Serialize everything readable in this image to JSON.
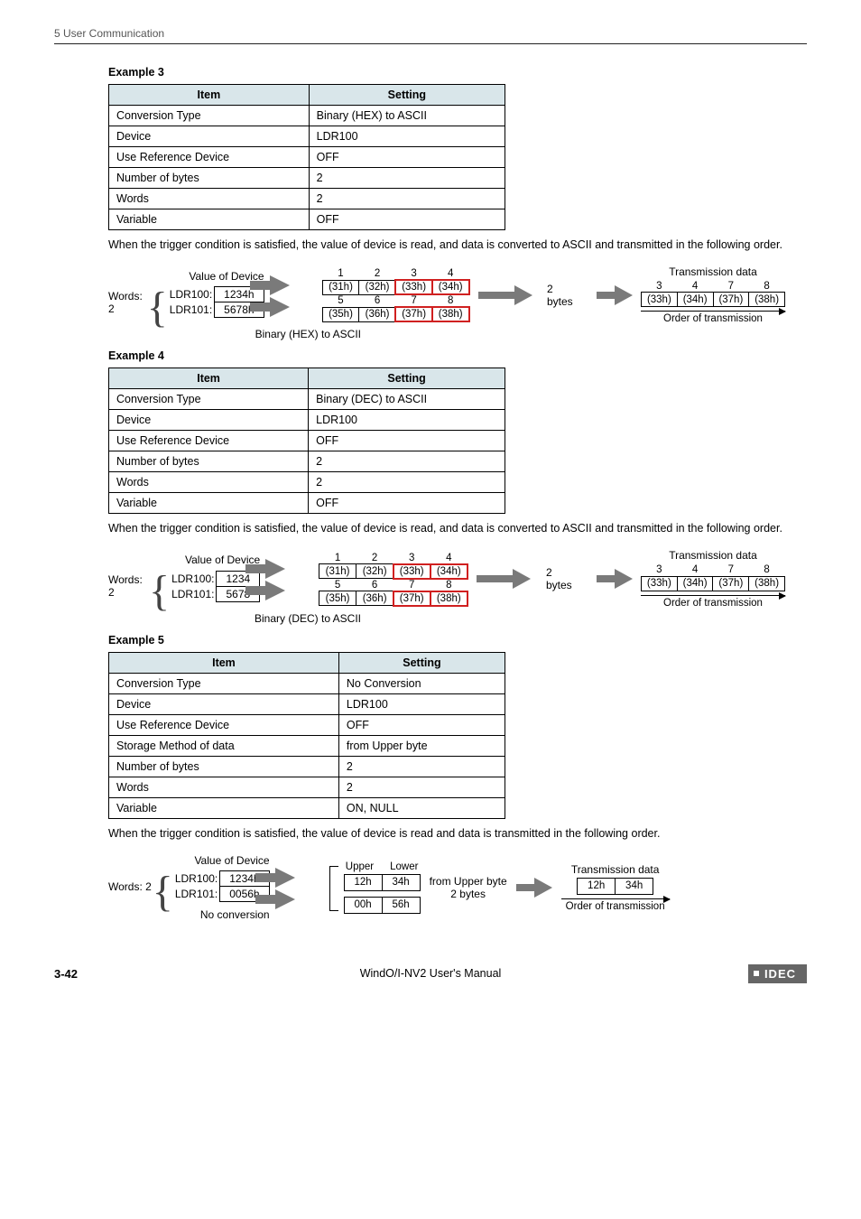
{
  "header": {
    "chapter": "5 User Communication"
  },
  "example3": {
    "title": "Example 3",
    "headers": {
      "item": "Item",
      "setting": "Setting"
    },
    "rows": [
      {
        "item": "Conversion Type",
        "setting": "Binary (HEX) to ASCII"
      },
      {
        "item": "Device",
        "setting": "LDR100"
      },
      {
        "item": "Use Reference Device",
        "setting": "OFF"
      },
      {
        "item": "Number of bytes",
        "setting": "2"
      },
      {
        "item": "Words",
        "setting": "2"
      },
      {
        "item": "Variable",
        "setting": "OFF"
      }
    ],
    "para": "When the trigger condition is satisfied, the value of device is read, and data is converted to ASCII and transmitted in the following order.",
    "diagram": {
      "vod": "Value of Device",
      "words": "Words: 2",
      "ldr": [
        {
          "name": "LDR100:",
          "val": "1234h"
        },
        {
          "name": "LDR101:",
          "val": "5678h"
        }
      ],
      "conv": "Binary (HEX) to ASCII",
      "grid8": {
        "idx": [
          "1",
          "2",
          "3",
          "4",
          "5",
          "6",
          "7",
          "8"
        ],
        "cells": [
          "(31h)",
          "(32h)",
          "(33h)",
          "(34h)",
          "(35h)",
          "(36h)",
          "(37h)",
          "(38h)"
        ]
      },
      "bytes": "2 bytes",
      "transLabel": "Transmission data",
      "trans": {
        "idx": [
          "3",
          "4",
          "7",
          "8"
        ],
        "cells": [
          "(33h)",
          "(34h)",
          "(37h)",
          "(38h)"
        ]
      },
      "order": "Order of transmission"
    }
  },
  "example4": {
    "title": "Example 4",
    "headers": {
      "item": "Item",
      "setting": "Setting"
    },
    "rows": [
      {
        "item": "Conversion Type",
        "setting": "Binary (DEC) to ASCII"
      },
      {
        "item": "Device",
        "setting": "LDR100"
      },
      {
        "item": "Use Reference Device",
        "setting": "OFF"
      },
      {
        "item": "Number of bytes",
        "setting": "2"
      },
      {
        "item": "Words",
        "setting": "2"
      },
      {
        "item": "Variable",
        "setting": "OFF"
      }
    ],
    "para": "When the trigger condition is satisfied, the value of device is read, and data is converted to ASCII and transmitted in the following order.",
    "diagram": {
      "vod": "Value of Device",
      "words": "Words: 2",
      "ldr": [
        {
          "name": "LDR100:",
          "val": "1234"
        },
        {
          "name": "LDR101:",
          "val": "5678"
        }
      ],
      "conv": "Binary (DEC) to ASCII",
      "grid8": {
        "idx": [
          "1",
          "2",
          "3",
          "4",
          "5",
          "6",
          "7",
          "8"
        ],
        "cells": [
          "(31h)",
          "(32h)",
          "(33h)",
          "(34h)",
          "(35h)",
          "(36h)",
          "(37h)",
          "(38h)"
        ]
      },
      "bytes": "2 bytes",
      "transLabel": "Transmission data",
      "trans": {
        "idx": [
          "3",
          "4",
          "7",
          "8"
        ],
        "cells": [
          "(33h)",
          "(34h)",
          "(37h)",
          "(38h)"
        ]
      },
      "order": "Order of transmission"
    }
  },
  "example5": {
    "title": "Example 5",
    "headers": {
      "item": "Item",
      "setting": "Setting"
    },
    "rows": [
      {
        "item": "Conversion Type",
        "setting": "No Conversion"
      },
      {
        "item": "Device",
        "setting": "LDR100"
      },
      {
        "item": "Use Reference Device",
        "setting": "OFF"
      },
      {
        "item": "Storage Method of data",
        "setting": "from Upper byte"
      },
      {
        "item": "Number of bytes",
        "setting": "2"
      },
      {
        "item": "Words",
        "setting": "2"
      },
      {
        "item": "Variable",
        "setting": "ON, NULL"
      }
    ],
    "para": "When the trigger condition is satisfied, the value of device is read and data is transmitted in the following order.",
    "diagram": {
      "vod": "Value of Device",
      "words": "Words: 2",
      "ldr": [
        {
          "name": "LDR100:",
          "val": "1234h"
        },
        {
          "name": "LDR101:",
          "val": "0056h"
        }
      ],
      "conv": "No conversion",
      "ul": {
        "upper": "Upper",
        "lower": "Lower"
      },
      "grid": {
        "r1": [
          "12h",
          "34h"
        ],
        "r2": [
          "00h",
          "56h"
        ]
      },
      "from": "from Upper byte",
      "bytes": "2 bytes",
      "transLabel": "Transmission data",
      "trans": [
        "12h",
        "34h"
      ],
      "order": "Order of transmission"
    }
  },
  "footer": {
    "page": "3-42",
    "manual": "WindO/I-NV2 User's Manual",
    "brand": "IDEC"
  }
}
